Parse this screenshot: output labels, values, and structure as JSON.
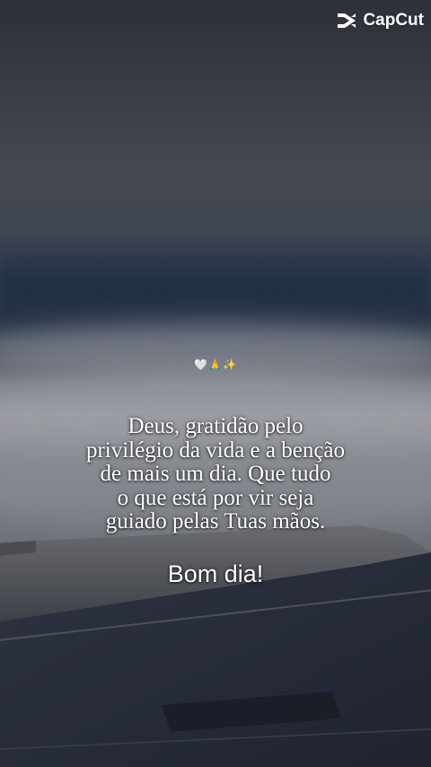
{
  "watermark": {
    "brand": "CapCut",
    "icon": "capcut-logo-icon"
  },
  "post": {
    "emojis": {
      "heart": "🤍",
      "hands": "🙏",
      "sparkle": "✨"
    },
    "message_lines": [
      "Deus, gratidão pelo",
      "privilégio da vida e a benção",
      "de mais um dia. Que tudo",
      "o que está por vir seja",
      "guiado pelas Tuas mãos."
    ],
    "greeting": "Bom dia!"
  },
  "colors": {
    "text": "#ffffff",
    "sky_dark": "#2d3038",
    "clouds": "#9a9ca2",
    "wing": "#2b2f3c"
  }
}
